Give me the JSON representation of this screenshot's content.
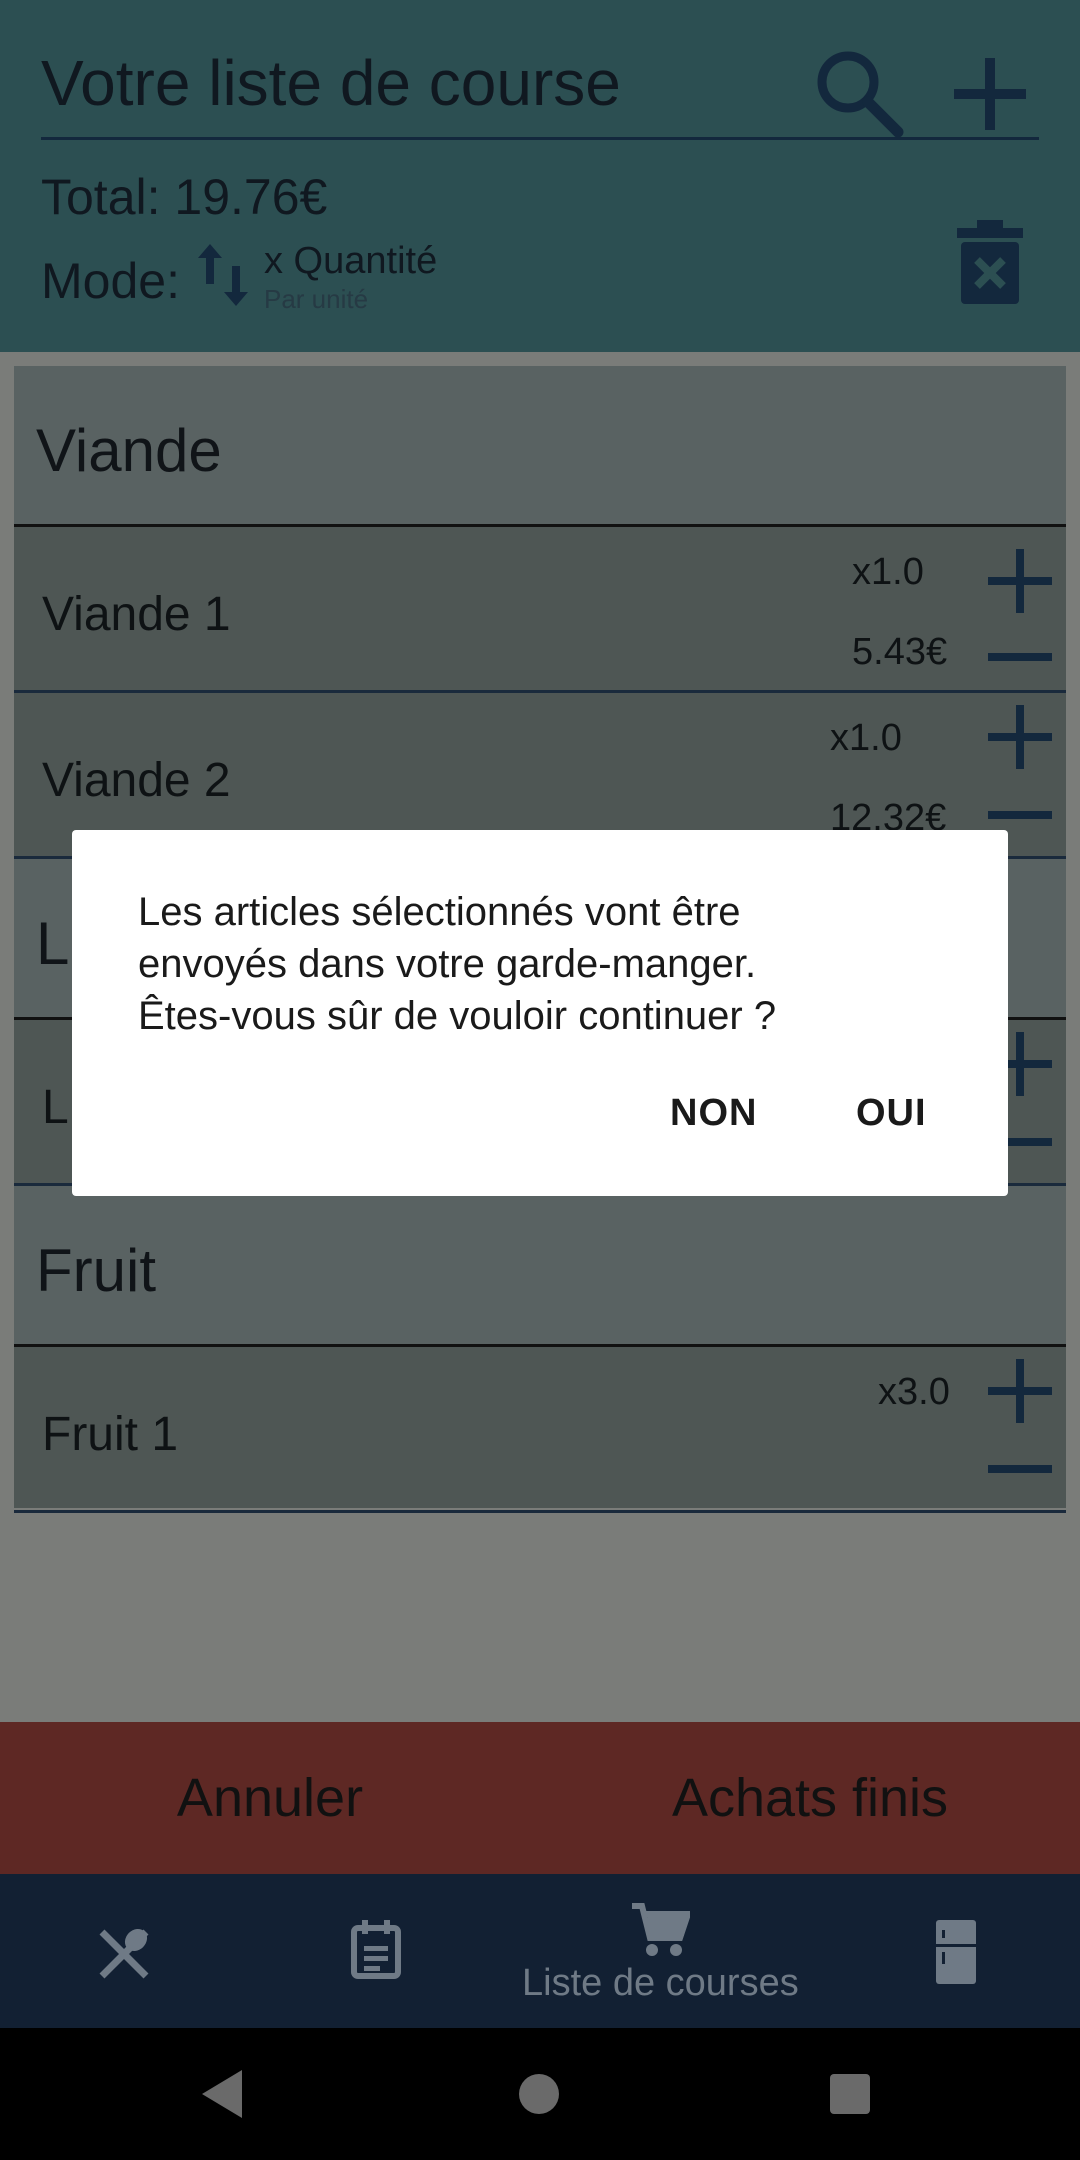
{
  "header": {
    "title": "Votre liste de course",
    "total": "Total: 19.76€",
    "mode_label": "Mode:",
    "mode_main": "x Quantité",
    "mode_sub": "Par unité"
  },
  "list": {
    "categories": [
      {
        "name": "Viande",
        "items": [
          {
            "name": "Viande 1",
            "qty": "x1.0",
            "price": "5.43€"
          },
          {
            "name": "Viande 2",
            "qty": "x1.0",
            "price": "12.32€"
          }
        ]
      },
      {
        "name": "L",
        "items": [
          {
            "name": "L",
            "qty": "",
            "price": ""
          }
        ]
      },
      {
        "name": "Fruit",
        "items": [
          {
            "name": "Fruit 1",
            "qty": "x3.0",
            "price": ""
          }
        ]
      }
    ]
  },
  "actions": {
    "cancel": "Annuler",
    "finish": "Achats finis"
  },
  "nav": {
    "items": [
      {
        "icon": "utensils-icon",
        "label": ""
      },
      {
        "icon": "calendar-icon",
        "label": ""
      },
      {
        "icon": "cart-icon",
        "label": "Liste de courses"
      },
      {
        "icon": "fridge-icon",
        "label": ""
      }
    ]
  },
  "dialog": {
    "message_line1": "Les articles sélectionnés vont être",
    "message_line2": "envoyés dans votre garde-manger.",
    "message_line3": "Êtes-vous sûr de vouloir continuer ?",
    "no_label": "NON",
    "yes_label": "OUI"
  },
  "colors": {
    "header_bg": "#2c4f52",
    "action_bar_bg": "#5e2824",
    "nav_bg": "#122033",
    "icon_dark": "#13283d"
  }
}
